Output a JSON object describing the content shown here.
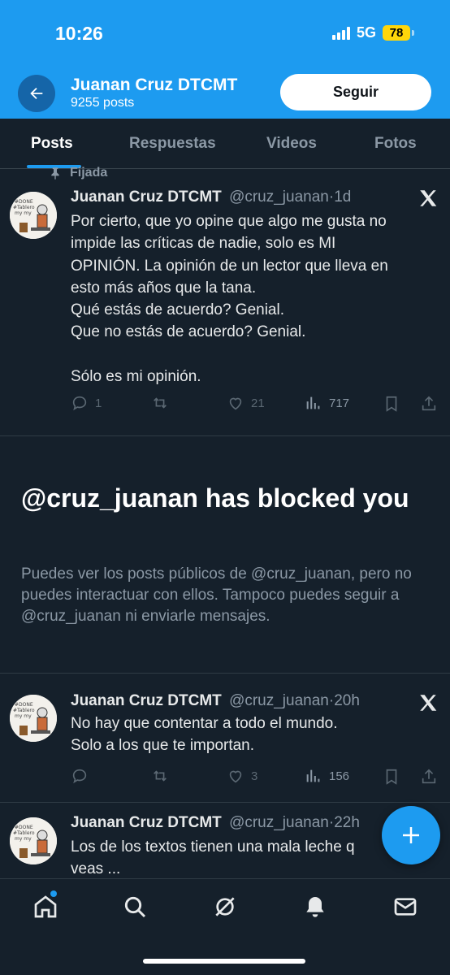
{
  "status_bar": {
    "time": "10:26",
    "network": "5G",
    "battery": "78"
  },
  "header": {
    "name": "Juanan Cruz DTCMT",
    "posts_count": "9255 posts",
    "follow_label": "Seguir"
  },
  "tabs": [
    {
      "label": "Posts",
      "active": true
    },
    {
      "label": "Respuestas",
      "active": false
    },
    {
      "label": "Videos",
      "active": false
    },
    {
      "label": "Fotos",
      "active": false
    }
  ],
  "pinned_label": "Fijada",
  "posts": [
    {
      "name": "Juanan Cruz DTCMT",
      "handle": "@cruz_juanan",
      "time": "1d",
      "lines": [
        "Por cierto, que yo opine que algo me gusta no",
        "impide las críticas de nadie, solo es MI",
        "OPINIÓN. La opinión de un lector que lleva en",
        "esto más años que la tana.",
        "Qué estás de acuerdo? Genial.",
        "Que no estás de acuerdo? Genial.",
        "",
        "Sólo es mi opinión."
      ],
      "replies": "1",
      "reposts": "",
      "likes": "21",
      "views": "717"
    },
    {
      "name": "Juanan Cruz DTCMT",
      "handle": "@cruz_juanan",
      "time": "20h",
      "lines": [
        "No hay que contentar a todo el mundo.",
        "Solo a los que te importan."
      ],
      "replies": "",
      "reposts": "",
      "likes": "3",
      "views": "156"
    },
    {
      "name": "Juanan Cruz DTCMT",
      "handle": "@cruz_juanan",
      "time": "22h",
      "lines": [
        "Los de los textos tienen una mala leche q",
        "veas ..."
      ]
    }
  ],
  "blocked": {
    "title": "@cruz_juanan has blocked you",
    "description": "Puedes ver los posts públicos de @cruz_juanan, pero no puedes interactuar con ellos. Tampoco puedes seguir a @cruz_juanan ni enviarle mensajes."
  },
  "icons": {
    "back": "back-arrow-icon",
    "x_logo": "x-logo-icon",
    "reply": "reply-icon",
    "repost": "repost-icon",
    "like": "heart-icon",
    "views": "views-icon",
    "bookmark": "bookmark-icon",
    "share": "share-icon",
    "compose": "plus-icon",
    "nav": [
      "home-icon",
      "search-icon",
      "grok-icon",
      "bell-icon",
      "mail-icon"
    ]
  },
  "colors": {
    "accent": "#1d9bf0",
    "background": "#15202b",
    "muted": "#8b98a5",
    "battery": "#ffd60a"
  }
}
